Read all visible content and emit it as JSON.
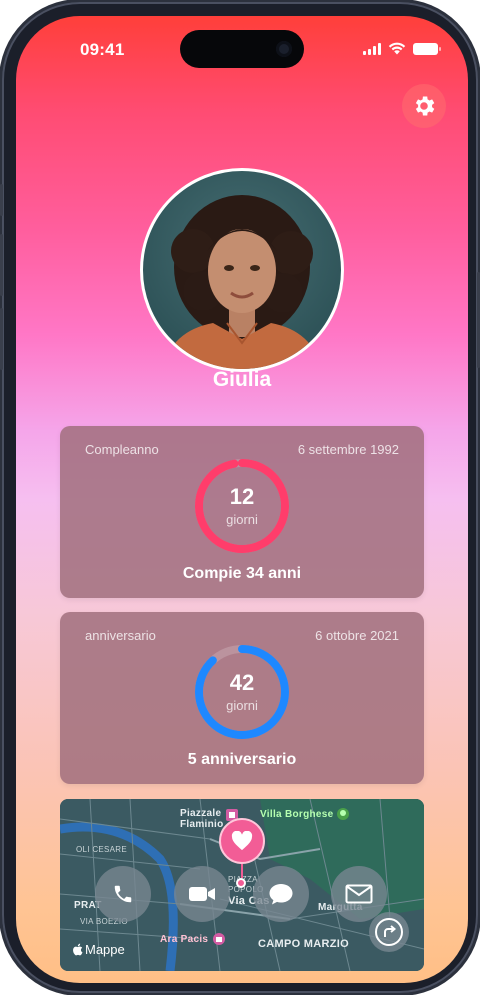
{
  "status_bar": {
    "time": "09:41"
  },
  "profile": {
    "name": "Giulia"
  },
  "cards": [
    {
      "label": "Compleanno",
      "date": "6 settembre 1992",
      "count": "12",
      "unit": "giorni",
      "caption": "Compie 34 anni",
      "ring_color": "#ff3d6b",
      "progress": 0.97
    },
    {
      "label": "anniversario",
      "date": "6 ottobre 2021",
      "count": "42",
      "unit": "giorni",
      "caption": "5 anniversario",
      "ring_color": "#1e88ff",
      "progress": 0.88
    }
  ],
  "map": {
    "labels": {
      "piazzale_flaminio": "Piazzale",
      "piazzale_flaminio_2": "Flaminio",
      "villa_borghese": "Villa Borghese",
      "cesare": "OLI CESARE",
      "boezio": "VIA BOEZIO",
      "prati": "PRAT",
      "piazza": "PIAZZA",
      "piazza_2": "POPOLO",
      "via_cassia": "Via Cas",
      "margutta": "Margutta",
      "ara_pacis": "Ara Pacis",
      "campo_marzio": "CAMPO MARZIO",
      "credit": "Mappe"
    }
  },
  "colors": {
    "pin": "#f25d96",
    "accent_red": "#ff3d6b",
    "accent_blue": "#1e88ff"
  },
  "icons": {
    "settings": "gear-icon",
    "call": "phone-icon",
    "video": "video-icon",
    "message": "message-bubble-icon",
    "mail": "mail-icon",
    "share": "share-arrow-icon",
    "pin": "heart-icon"
  }
}
